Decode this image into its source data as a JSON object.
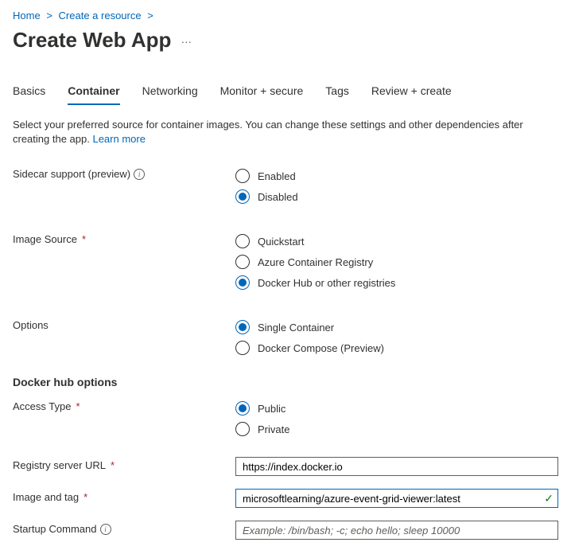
{
  "breadcrumb": {
    "home": "Home",
    "create": "Create a resource"
  },
  "title": "Create Web App",
  "tabs": {
    "basics": "Basics",
    "container": "Container",
    "networking": "Networking",
    "monitor": "Monitor + secure",
    "tags": "Tags",
    "review": "Review + create"
  },
  "desc": {
    "text": "Select your preferred source for container images. You can change these settings and other dependencies after creating the app.  ",
    "link": "Learn more"
  },
  "labels": {
    "sidecar": "Sidecar support (preview)",
    "imageSource": "Image Source",
    "options": "Options",
    "dockerHeader": "Docker hub options",
    "accessType": "Access Type",
    "registry": "Registry server URL",
    "imageTag": "Image and tag",
    "startup": "Startup Command"
  },
  "radios": {
    "sidecar": {
      "enabled": "Enabled",
      "disabled": "Disabled"
    },
    "imageSource": {
      "quickstart": "Quickstart",
      "acr": "Azure Container Registry",
      "docker": "Docker Hub or other registries"
    },
    "options": {
      "single": "Single Container",
      "compose": "Docker Compose (Preview)"
    },
    "access": {
      "public": "Public",
      "private": "Private"
    }
  },
  "inputs": {
    "registry": "https://index.docker.io",
    "imageTag": "microsoftlearning/azure-event-grid-viewer:latest",
    "startupPlaceholder": "Example: /bin/bash; -c; echo hello; sleep 10000"
  }
}
